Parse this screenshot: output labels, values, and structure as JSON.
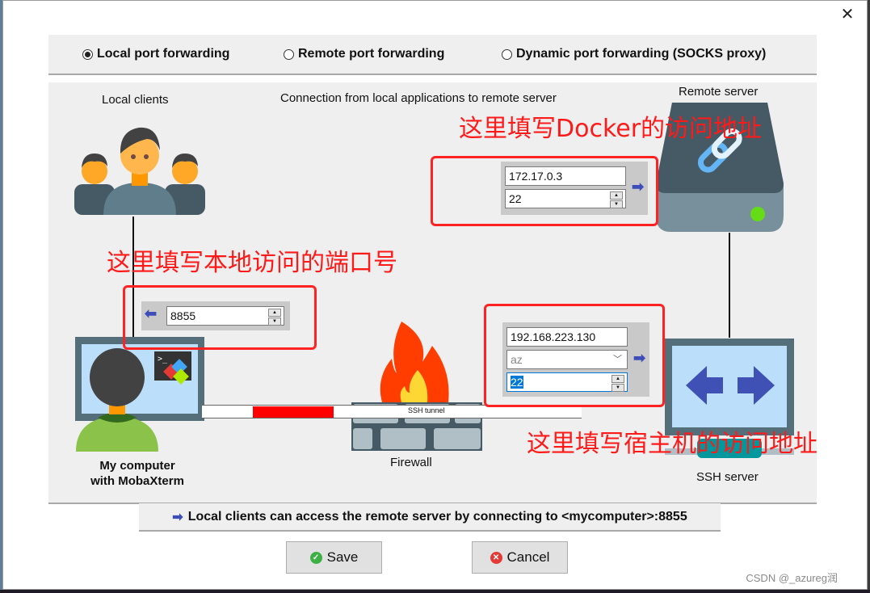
{
  "window": {
    "close_label": "✕"
  },
  "modes": [
    {
      "label": "Local port forwarding",
      "selected": true
    },
    {
      "label": "Remote port forwarding",
      "selected": false
    },
    {
      "label": "Dynamic port forwarding (SOCKS proxy)",
      "selected": false
    }
  ],
  "diagram": {
    "local_clients_label": "Local clients",
    "connection_caption": "Connection from local applications to remote server",
    "remote_server_label": "Remote server",
    "my_computer_label_line1": "My computer",
    "my_computer_label_line2": "with MobaXterm",
    "firewall_label": "Firewall",
    "ssh_server_label": "SSH server",
    "tunnel_label": "SSH tunnel"
  },
  "remote": {
    "host": "172.17.0.3",
    "port": "22"
  },
  "local": {
    "port": "8855"
  },
  "ssh": {
    "host": "192.168.223.130",
    "user": "az",
    "port": "22"
  },
  "annotations": {
    "docker": "这里填写Docker的访问地址",
    "local_port": "这里填写本地访问的端口号",
    "host": "这里填写宿主机的访问地址"
  },
  "info": {
    "text": "Local clients can access the remote server by connecting to <mycomputer>:8855"
  },
  "buttons": {
    "save": "Save",
    "cancel": "Cancel"
  },
  "watermark": "CSDN @_azureg润",
  "colors": {
    "accent_blue": "#3d4eb8",
    "annotation_red": "#ff1a1a",
    "tunnel_red": "#ff0000",
    "save_green": "#3cb043",
    "cancel_red": "#e53935"
  }
}
